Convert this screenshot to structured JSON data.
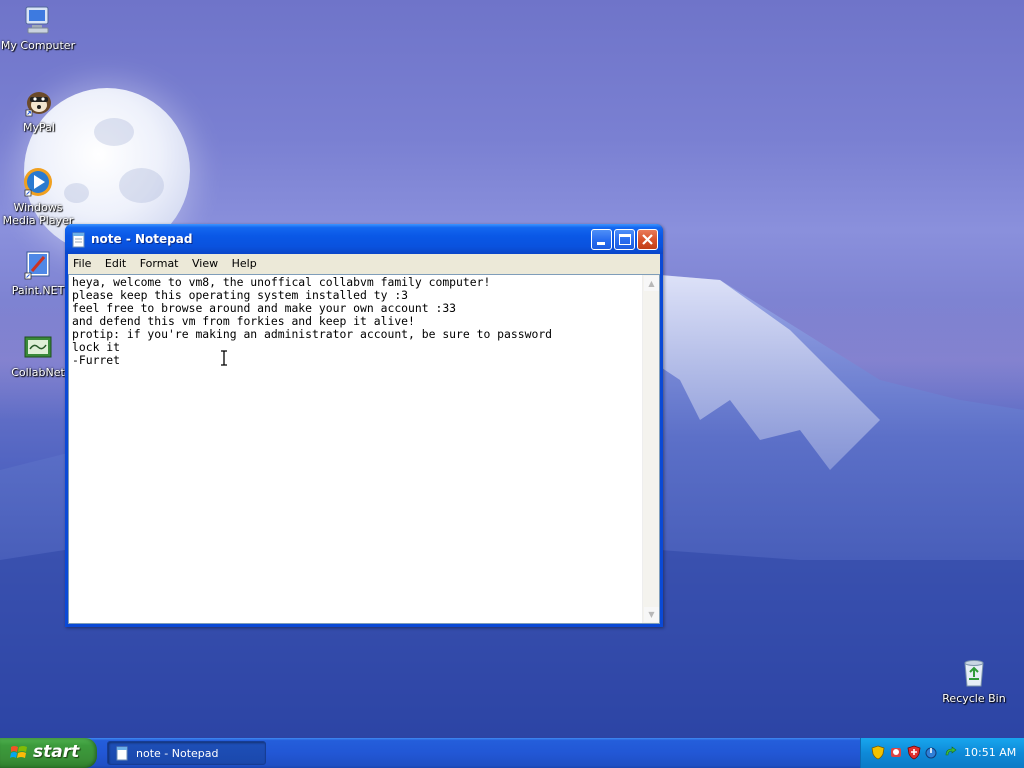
{
  "desktop": {
    "icons": [
      {
        "label": "My Computer"
      },
      {
        "label": "MyPal"
      },
      {
        "label": "Windows Media Player"
      },
      {
        "label": "Paint.NET"
      },
      {
        "label": "CollabNet"
      },
      {
        "label": "Recycle Bin"
      }
    ]
  },
  "window": {
    "title": "note - Notepad",
    "menu": [
      "File",
      "Edit",
      "Format",
      "View",
      "Help"
    ],
    "content": "heya, welcome to vm8, the unoffical collabvm family computer!\nplease keep this operating system installed ty :3\nfeel free to browse around and make your own account :33\nand defend this vm from forkies and keep it alive!\nprotip: if you're making an administrator account, be sure to password\nlock it\n-Furret"
  },
  "taskbar": {
    "start_label": "start",
    "task_label": "note - Notepad",
    "clock": "10:51 AM"
  },
  "colors": {
    "title_bar": "#0a52de",
    "taskbar": "#245edb",
    "start_button": "#3a8f37",
    "tray": "#0e8ad8",
    "close_button": "#d9532c"
  }
}
